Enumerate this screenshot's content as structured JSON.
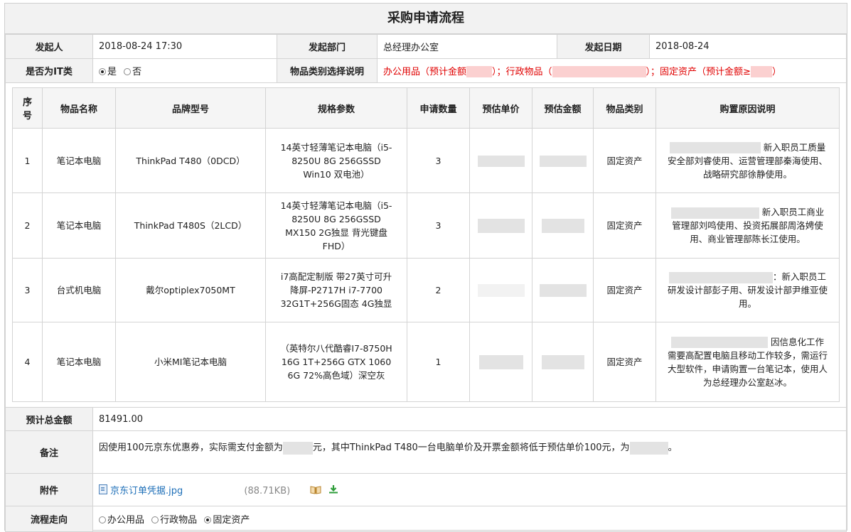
{
  "title": "采购申请流程",
  "row1": {
    "initiator_label": "发起人",
    "initiator_value": "2018-08-24 17:30",
    "dept_label": "发起部门",
    "dept_value": "总经理办公室",
    "date_label": "发起日期",
    "date_value": "2018-08-24"
  },
  "row2": {
    "it_label": "是否为IT类",
    "it_yes": "是",
    "it_no": "否",
    "it_selected": "是",
    "category_label": "物品类别选择说明",
    "category_part1": "办公用品（预计金额",
    "category_part2": "）；行政物品（",
    "category_part3": "）；固定资产（预计金额≥",
    "category_part4": "）"
  },
  "items": {
    "headers": [
      "序号",
      "物品名称",
      "品牌型号",
      "规格参数",
      "申请数量",
      "预估单价",
      "预估金额",
      "物品类别",
      "购置原因说明"
    ],
    "rows": [
      {
        "no": "1",
        "name": "笔记本电脑",
        "model": "ThinkPad T480（0DCD）",
        "spec": "14英寸轻薄笔记本电脑（i5-8250U 8G 256GSSD Win10 双电池）",
        "qty": "3",
        "category": "固定资产",
        "reason": "新入职员工质量安全部刘睿使用、运营管理部秦海使用、战略研究部徐静使用。"
      },
      {
        "no": "2",
        "name": "笔记本电脑",
        "model": "ThinkPad T480S（2LCD）",
        "spec": "14英寸轻薄笔记本电脑（i5-8250U 8G 256GSSD MX150 2G独显 背光键盘 FHD）",
        "qty": "3",
        "category": "固定资产",
        "reason": "新入职员工商业管理部刘鸣使用、投资拓展部周洛娉使用、商业管理部陈长江使用。"
      },
      {
        "no": "3",
        "name": "台式机电脑",
        "model": "戴尔optiplex7050MT",
        "spec": "i7高配定制版 带27英寸可升降屏-P2717H i7-7700 32G1T+256G固态 4G独显",
        "qty": "2",
        "category": "固定资产",
        "reason": "：新入职员工研发设计部彭子用、研发设计部尹维亚使用。"
      },
      {
        "no": "4",
        "name": "笔记本电脑",
        "model": "小米MI笔记本电脑",
        "spec": "（英特尔八代酷睿I7-8750H 16G 1T+256G GTX 1060 6G 72%高色域）深空灰",
        "qty": "1",
        "category": "固定资产",
        "reason": "因信息化工作需要高配置电脑且移动工作较多，需运行大型软件，申请购置一台笔记本，使用人为总经理办公室赵冰。"
      }
    ]
  },
  "total": {
    "label": "预计总金额",
    "value": "81491.00"
  },
  "remark": {
    "label": "备注",
    "part1": "因使用100元京东优惠券，实际需支付金额为",
    "part2": "元，其中ThinkPad T480一台电脑单价及开票金额将低于预估单价100元，为",
    "part3": "。"
  },
  "attachment": {
    "label": "附件",
    "filename": "京东订单凭据.jpg",
    "size": "(88.71KB)"
  },
  "flow": {
    "label": "流程走向",
    "options": [
      "办公用品",
      "行政物品",
      "固定资产"
    ],
    "selected": "固定资产"
  },
  "colors": {
    "red": "#e00000",
    "link": "#1e6fb8",
    "label_bg": "#f2f2f2",
    "border": "#d4d4d4"
  }
}
